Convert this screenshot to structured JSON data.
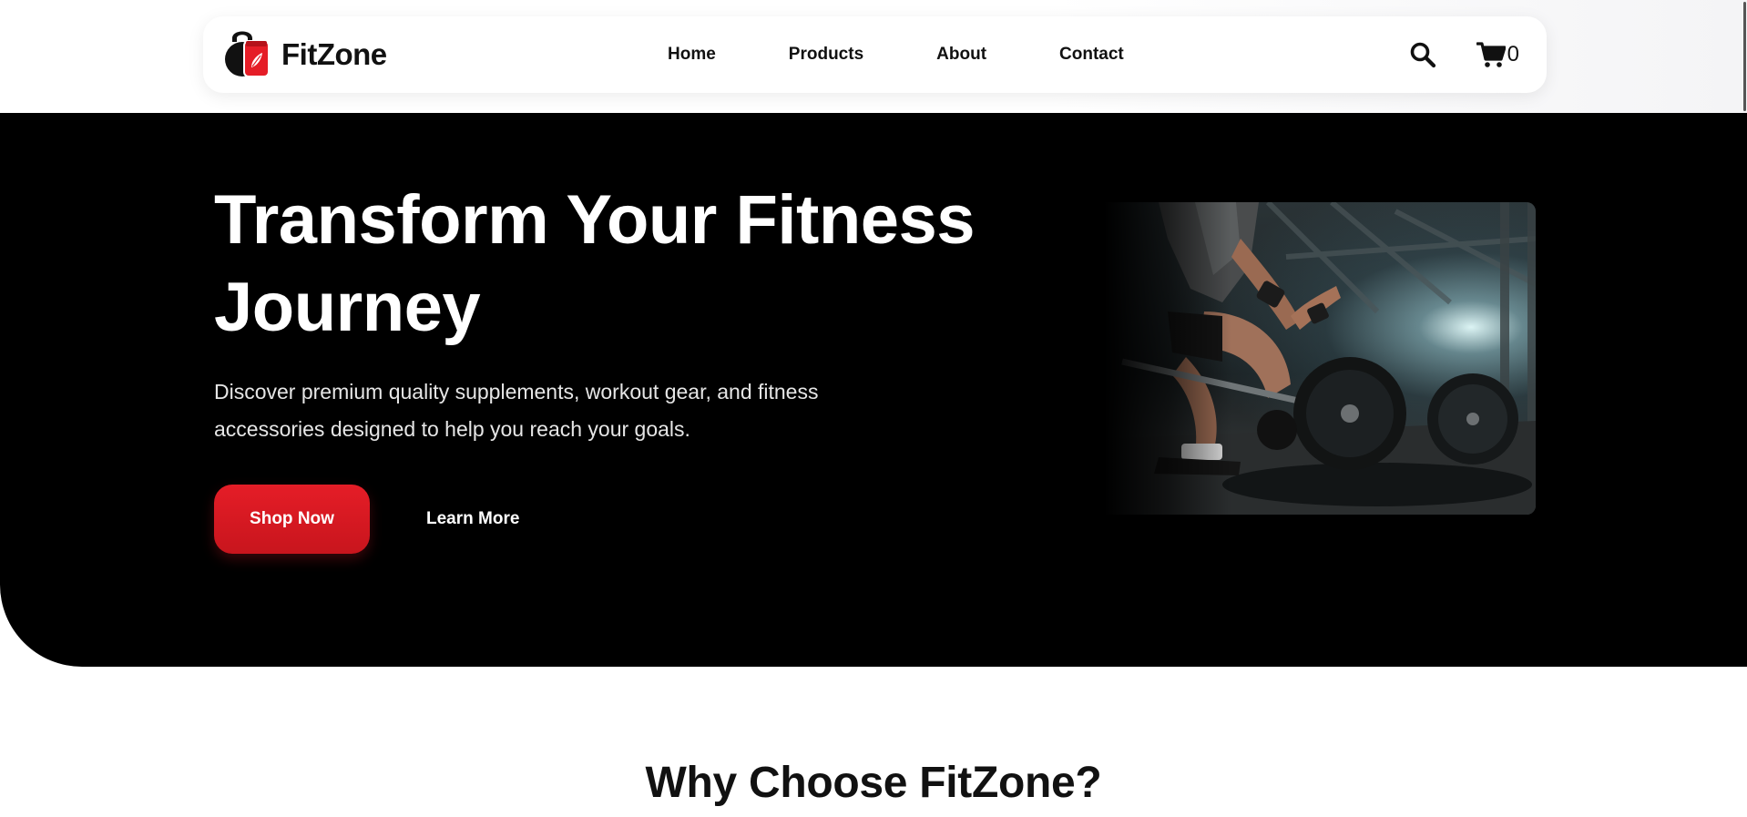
{
  "brand": {
    "name": "FitZone",
    "primary_color": "#e51d27",
    "dark_color": "#000000"
  },
  "nav": {
    "links": [
      "Home",
      "Products",
      "About",
      "Contact"
    ]
  },
  "cart": {
    "count": "0"
  },
  "hero": {
    "title": "Transform Your Fitness Journey",
    "subtitle": "Discover premium quality supplements, workout gear, and fitness accessories designed to help you reach your goals.",
    "primary_cta": "Shop Now",
    "secondary_cta": "Learn More"
  },
  "features": {
    "title": "Why Choose FitZone?"
  },
  "icons": {
    "logo": "kettlebell-logo-icon",
    "search": "search-icon",
    "cart": "cart-icon"
  }
}
